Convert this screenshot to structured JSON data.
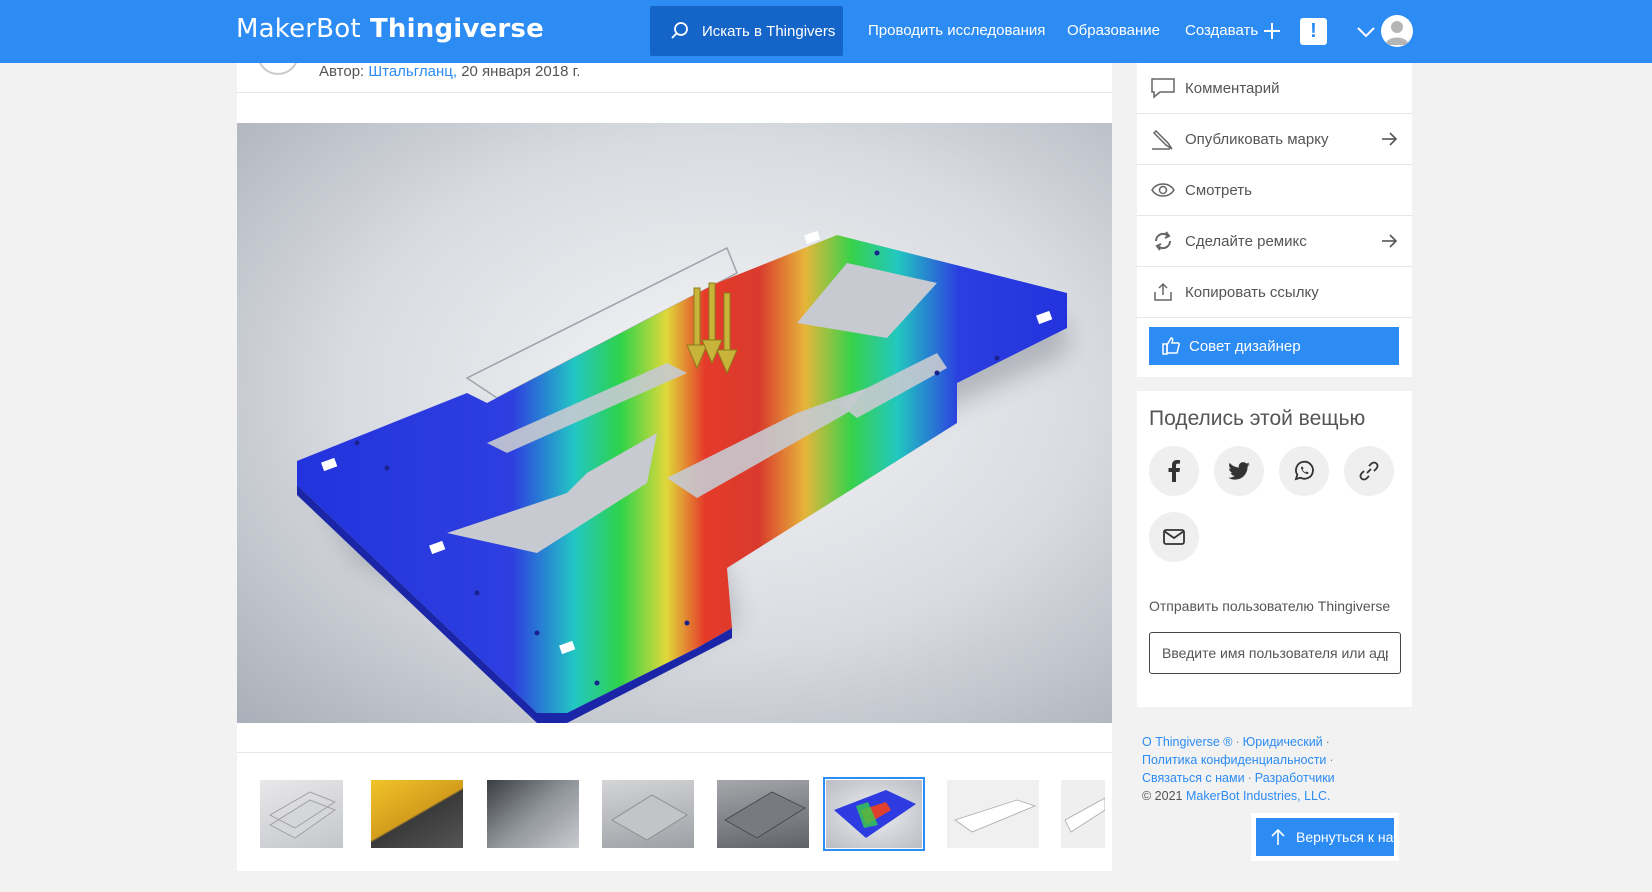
{
  "header": {
    "logo_part1": "MakerBot",
    "logo_part2": "Thingiverse",
    "search_label": "Искать в Thingivers",
    "nav": {
      "explore": "Проводить исследования",
      "education": "Образование",
      "create": "Создавать"
    },
    "notification_label": "!"
  },
  "thing": {
    "author_prefix": "Автор:",
    "author_name": "Штальгланц,",
    "date": "20 января 2018 г."
  },
  "actions": {
    "comment": "Комментарий",
    "post_make": "Опубликовать марку",
    "watch": "Смотреть",
    "remix": "Сделайте ремикс",
    "copy_link": "Копировать ссылку",
    "tip": "Совет дизайнер"
  },
  "share": {
    "title": "Поделись этой вещью",
    "send_label": "Отправить пользователю Thingiverse",
    "send_placeholder": "Введите имя пользователя или адрес"
  },
  "footer": {
    "about": "О Thingiverse ®",
    "legal": "Юридический",
    "privacy": "Политика конфиденциальности",
    "contact": "Связаться с нами",
    "developers": "Разработчики",
    "copyright_prefix": "© 2021",
    "company": "MakerBot Industries, LLC."
  },
  "back_to_top": "Вернуться к началу",
  "colors": {
    "brand_blue": "#2c8cf4",
    "search_blue": "#1565c8"
  }
}
